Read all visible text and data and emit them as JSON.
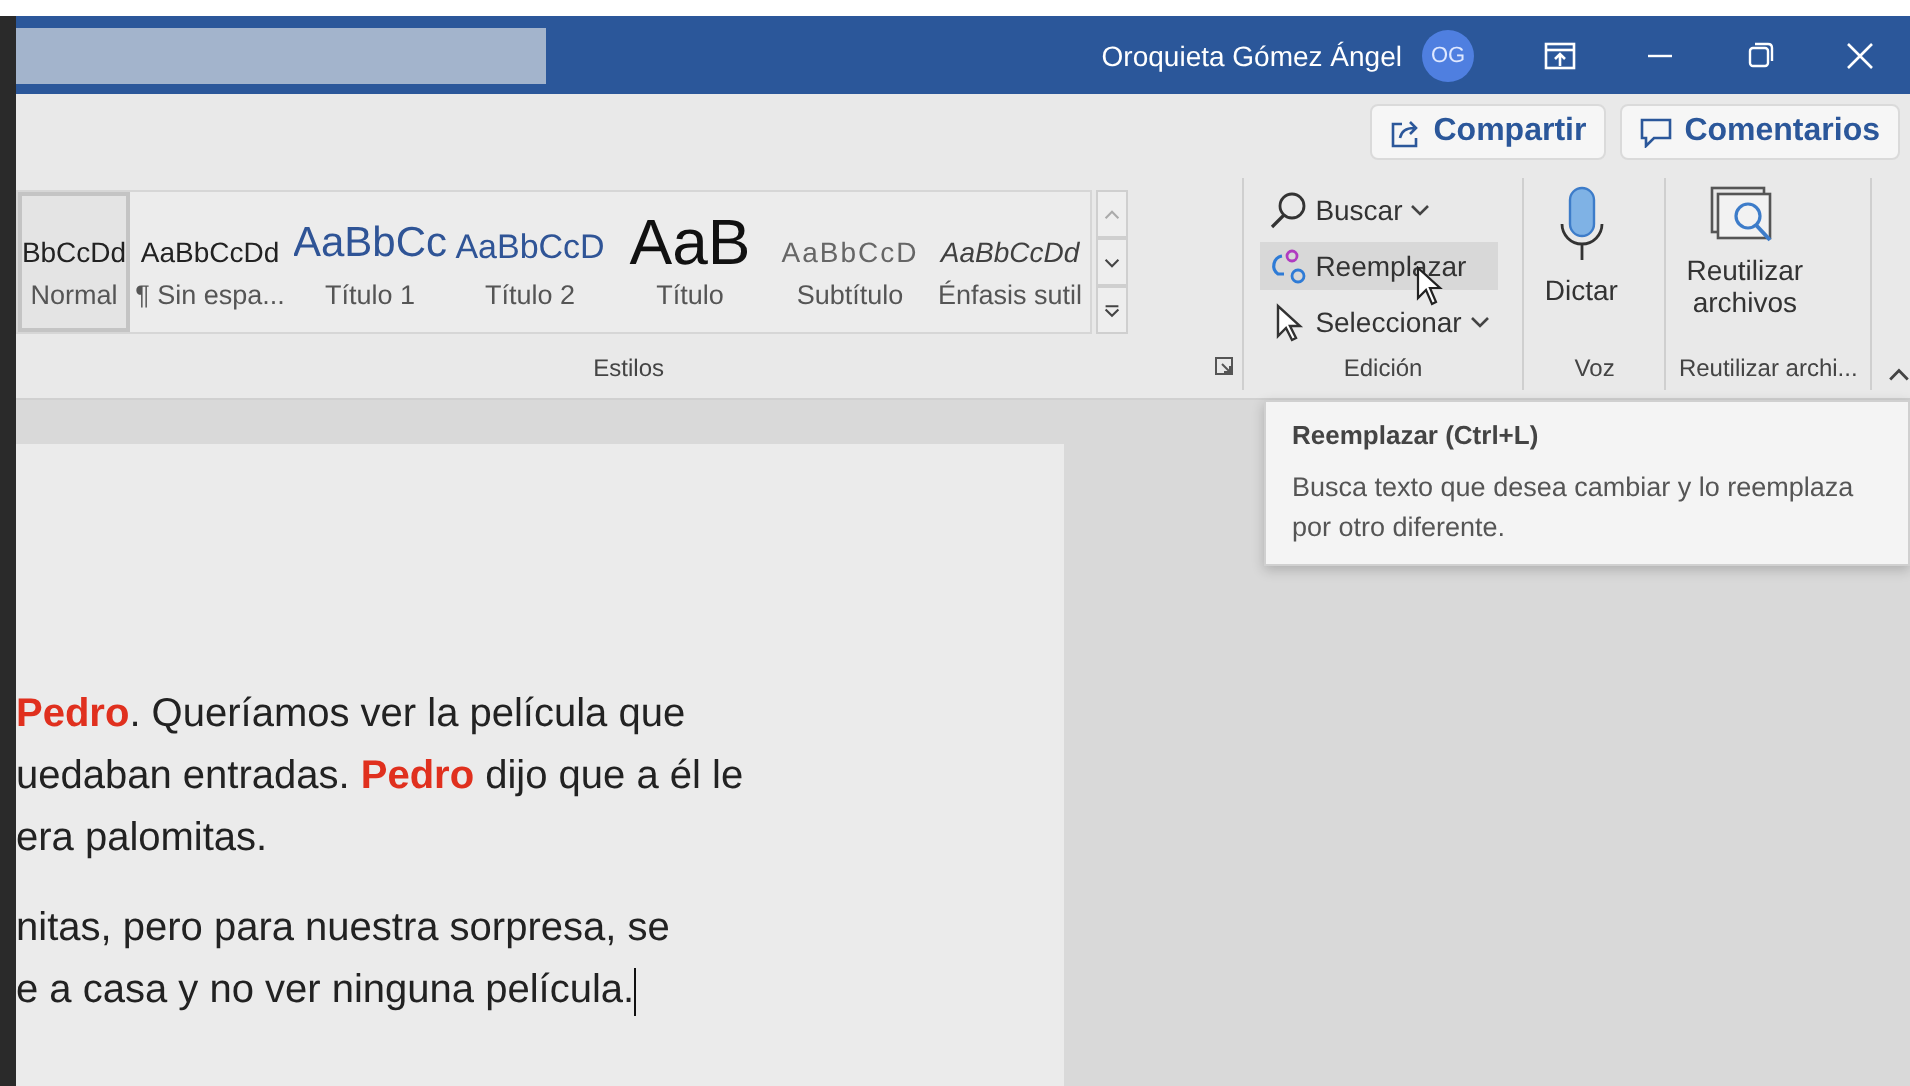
{
  "title_bar": {
    "user_name": "Oroquieta Gómez Ángel",
    "avatar_initials": "OG"
  },
  "header_buttons": [
    {
      "label": "Compartir",
      "kind": "share"
    },
    {
      "label": "Comentarios",
      "kind": "comment"
    }
  ],
  "styles_gallery": {
    "items": [
      {
        "preview": "BbCcDd",
        "name": "Normal",
        "kind": "normal",
        "selected": true
      },
      {
        "preview": "AaBbCcDd",
        "name": "¶ Sin espa...",
        "kind": "normal",
        "selected": false
      },
      {
        "preview": "AaBbCc",
        "name": "Título 1",
        "kind": "heading1",
        "selected": false
      },
      {
        "preview": "AaBbCcD",
        "name": "Título 2",
        "kind": "heading2",
        "selected": false
      },
      {
        "preview": "AaB",
        "name": "Título",
        "kind": "title",
        "selected": false
      },
      {
        "preview": "AaBbCcD",
        "name": "Subtítulo",
        "kind": "subtitle",
        "selected": false
      },
      {
        "preview": "AaBbCcDd",
        "name": "Énfasis sutil",
        "kind": "emphasis",
        "selected": false
      }
    ],
    "group_label": "Estilos"
  },
  "editing": {
    "commands": [
      {
        "label": "Buscar",
        "kind": "find",
        "dropdown": true,
        "hovered": false
      },
      {
        "label": "Reemplazar",
        "kind": "replace",
        "dropdown": false,
        "hovered": true
      },
      {
        "label": "Seleccionar",
        "kind": "select",
        "dropdown": true,
        "hovered": false
      }
    ],
    "group_label": "Edición"
  },
  "voice": {
    "button": "Dictar",
    "group_label": "Voz"
  },
  "reuse": {
    "button": [
      "Reutilizar",
      "archivos"
    ],
    "group_label": "Reutilizar archi..."
  },
  "tooltip": {
    "title": "Reemplazar (Ctrl+L)",
    "text": "Busca texto que desea cambiar y lo reemplaza por otro diferente."
  },
  "document": {
    "paragraphs": [
      [
        [
          {
            "text": "Pedro",
            "highlight": true
          },
          {
            "text": ". Queríamos ver la película que",
            "highlight": false
          }
        ],
        [
          {
            "text": "uedaban entradas. ",
            "highlight": false
          },
          {
            "text": "Pedro",
            "highlight": true
          },
          {
            "text": " dijo que a él le",
            "highlight": false
          }
        ],
        [
          {
            "text": "era palomitas.",
            "highlight": false
          }
        ]
      ],
      [
        [
          {
            "text": "nitas, pero para nuestra sorpresa, se",
            "highlight": false
          }
        ],
        [
          {
            "text": "e a casa y no ver ninguna película.",
            "highlight": false
          }
        ]
      ]
    ]
  }
}
